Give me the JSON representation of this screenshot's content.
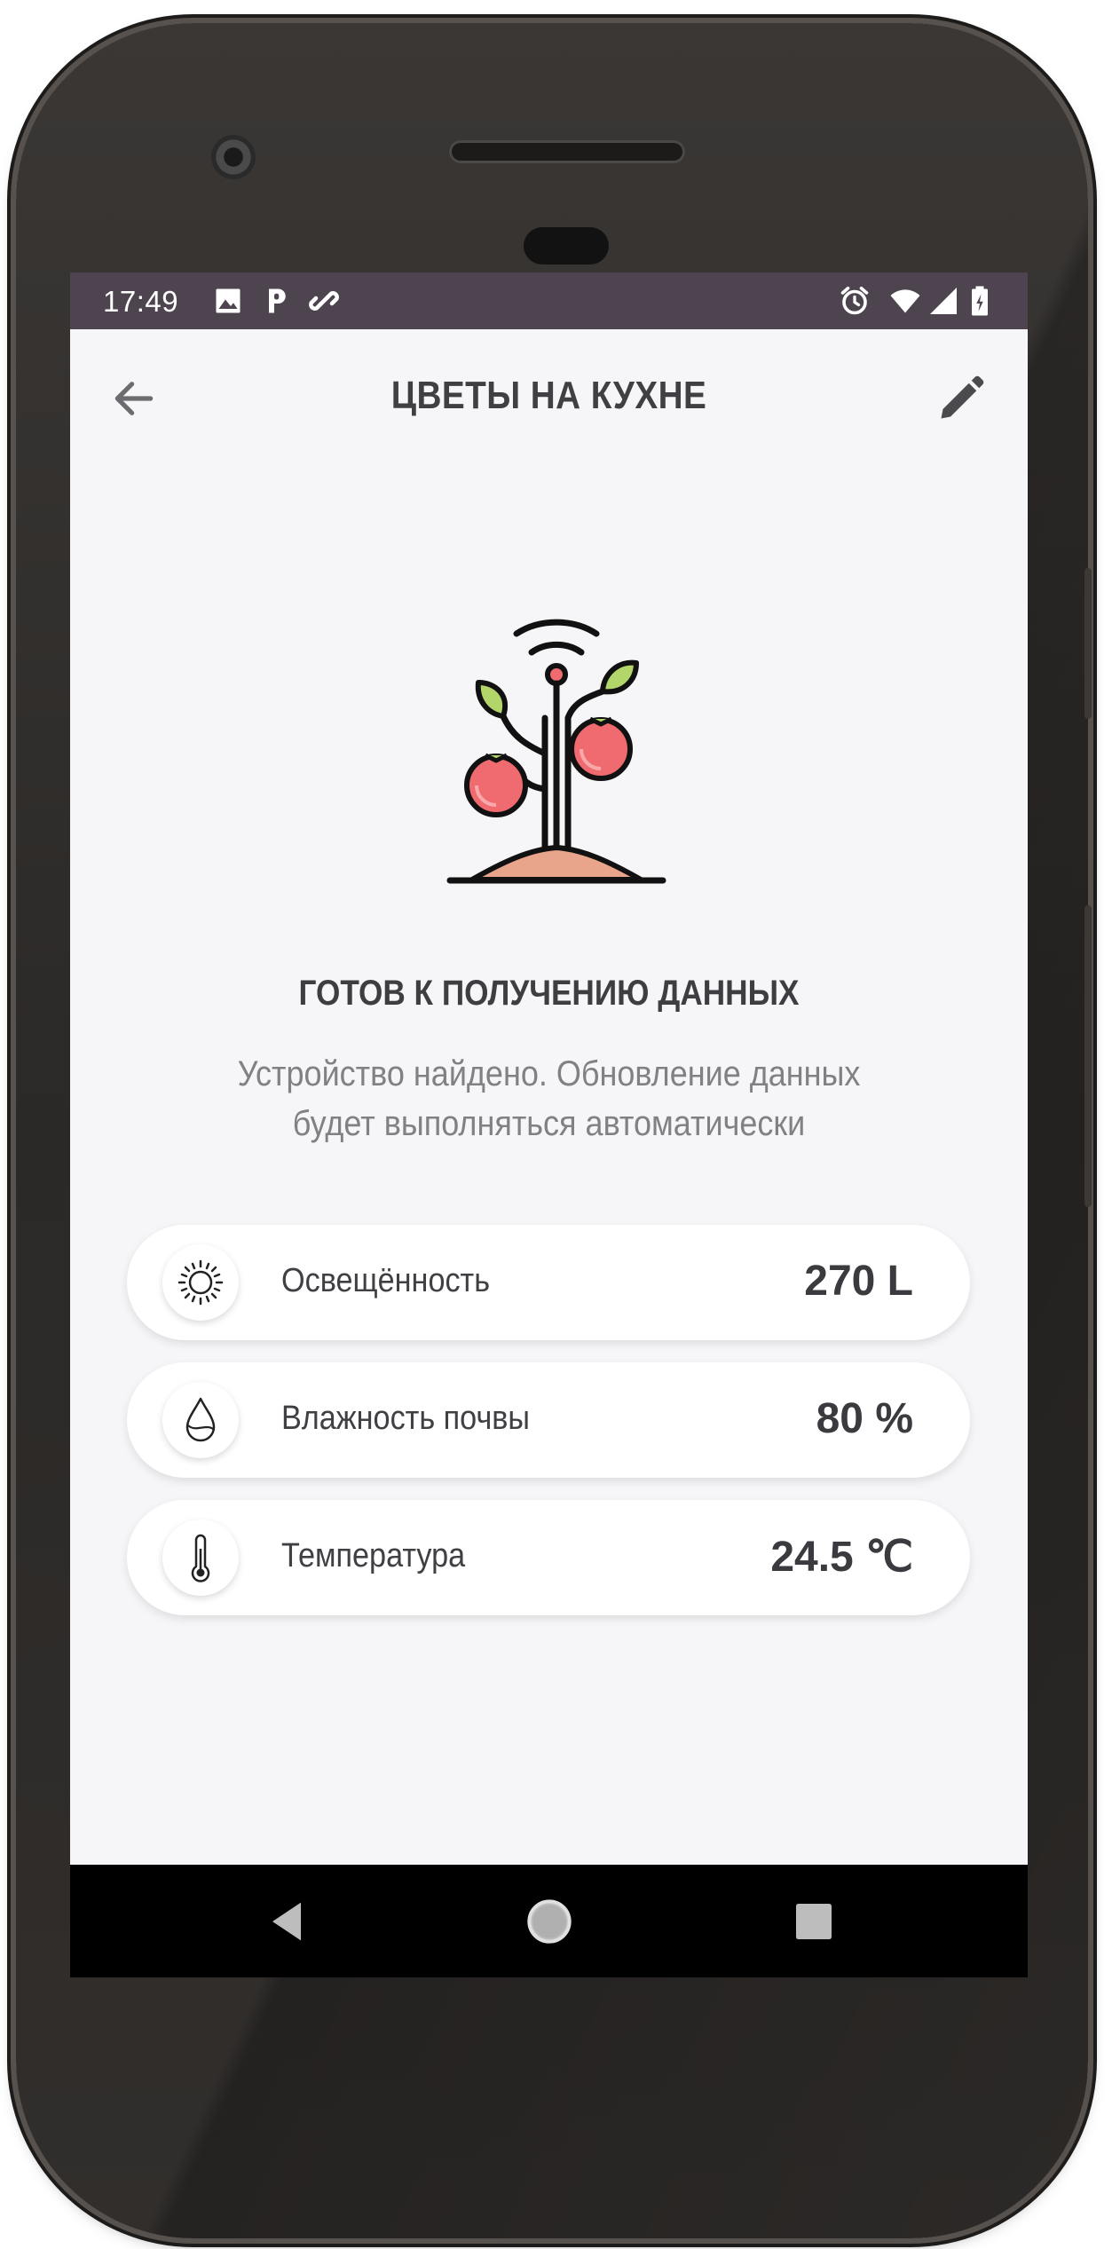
{
  "status_bar": {
    "time": "17:49",
    "left_icons": [
      "image-icon",
      "parking-icon",
      "link-icon"
    ],
    "right_icons": [
      "alarm-icon",
      "wifi-icon",
      "cell-signal-icon",
      "battery-icon"
    ]
  },
  "header": {
    "title": "ЦВЕТЫ НА КУХНЕ",
    "back_icon": "arrow-left-icon",
    "edit_icon": "pencil-icon"
  },
  "hero": {
    "icon": "smart-plant-icon"
  },
  "status": {
    "title": "ГОТОВ К ПОЛУЧЕНИЮ ДАННЫХ",
    "description_line1": "Устройство найдено. Обновление данных",
    "description_line2": "будет выполняться автоматически"
  },
  "sensors": [
    {
      "icon": "sun-icon",
      "label": "Освещённость",
      "value": "270 L"
    },
    {
      "icon": "water-drop-icon",
      "label": "Влажность почвы",
      "value": "80 %"
    },
    {
      "icon": "thermometer-icon",
      "label": "Температура",
      "value": "24.5 ℃"
    }
  ],
  "nav_bar": {
    "back": "nav-back-icon",
    "home": "nav-home-icon",
    "recents": "nav-recents-icon"
  },
  "colors": {
    "status_bar": "#4e4450",
    "screen_background": "#f6f6f8",
    "fruit": "#f06b6f",
    "leaf": "#b3d66a",
    "soil": "#e9a58c"
  }
}
